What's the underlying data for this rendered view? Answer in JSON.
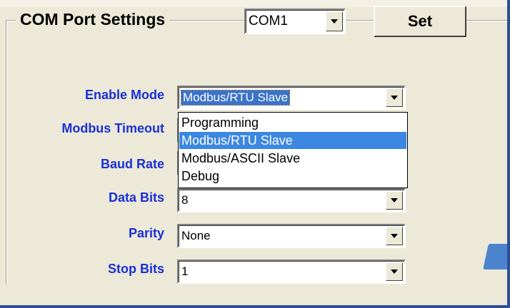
{
  "group": {
    "title": "COM Port Settings"
  },
  "com_port": {
    "selected": "COM1"
  },
  "set_button": {
    "label": "Set"
  },
  "fields": {
    "enable_mode": {
      "label": "Enable Mode",
      "value": "Modbus/RTU Slave"
    },
    "modbus_timeout": {
      "label": "Modbus Timeout",
      "value": ""
    },
    "baud_rate": {
      "label": "Baud Rate",
      "value": ""
    },
    "data_bits": {
      "label": "Data Bits",
      "value": "8"
    },
    "parity": {
      "label": "Parity",
      "value": "None"
    },
    "stop_bits": {
      "label": "Stop Bits",
      "value": "1"
    }
  },
  "dropdown": {
    "options": [
      "Programming",
      "Modbus/RTU Slave",
      "Modbus/ASCII Slave",
      "Debug"
    ],
    "selected_index": 1
  },
  "colors": {
    "label_text": "#1a2fd6",
    "selection": "#3b87e1",
    "frame_border": "#2e4f94",
    "background": "#ece9d8"
  }
}
